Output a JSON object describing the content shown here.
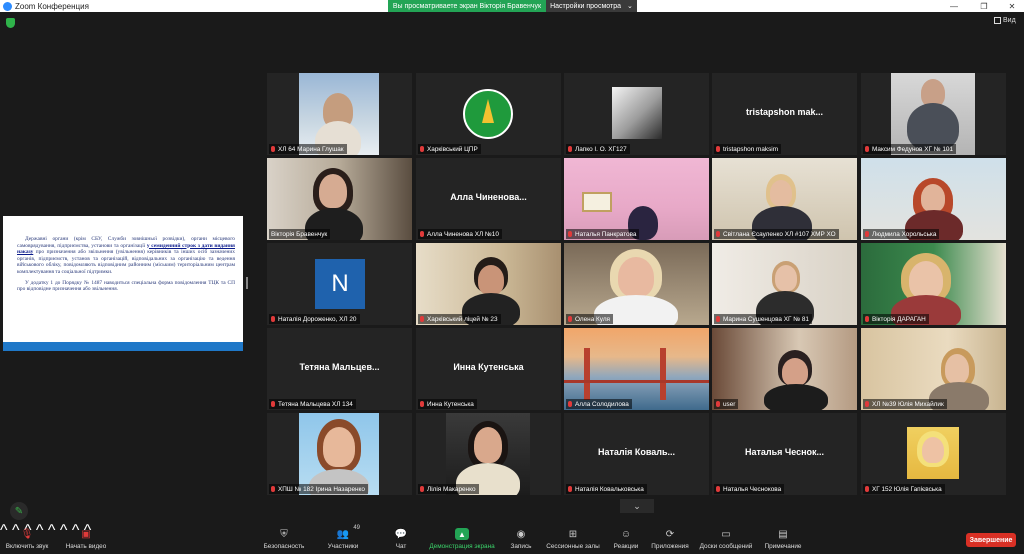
{
  "window": {
    "title": "Zoom Конференция",
    "share_banner": "Вы просматриваете экран Вікторія Бравенчук",
    "view_options": "Настройки просмотра",
    "view_button": "Вид"
  },
  "shared_doc": {
    "paragraph1_a": "Державні органи (крім СБУ, Служби зовнішньої розвідки), органи місцевого самоврядування, підприємства, установи та організації",
    "paragraph1_highlight": "у семиденний строк з дати видання наказу",
    "paragraph1_b": "про призначення або звільнення (увільнення) керівників та інших осіб зазначених органів, підприємств, установ та організацій, відповідальних за організацію та ведення військового обліку, повідомляють відповідним районним (міським) територіальним центрам комплектування та соціальної підтримки.",
    "paragraph2": "У додатку 1 до Порядку № 1487 наводиться спеціальна форма повідомлення ТЦК та СП про відповідне призначення або звільнення."
  },
  "participants": [
    {
      "name": "ХЛ 64 Марина Глушак",
      "display": "",
      "muted": true
    },
    {
      "name": "Харківський ЦПР",
      "display": "",
      "muted": true
    },
    {
      "name": "Лапко І. О. ХГ127",
      "display": "",
      "muted": true
    },
    {
      "name": "tristapshon maksim",
      "display": "tristapshon mak...",
      "muted": true
    },
    {
      "name": "Максим Федунов ХГ № 101",
      "display": "",
      "muted": true
    },
    {
      "name": "Вікторія Бравенчук",
      "display": "",
      "muted": false
    },
    {
      "name": "Алла Чиненова ХЛ №10",
      "display": "Алла Чиненова...",
      "muted": true
    },
    {
      "name": "Наталья Панкратова",
      "display": "",
      "muted": true
    },
    {
      "name": "Світлана Єсауленко ХЛ #107 ХМР ХО",
      "display": "",
      "muted": true
    },
    {
      "name": "Людмила Хорольська",
      "display": "",
      "muted": true
    },
    {
      "name": "Наталія Дороженко, ХЛ 20",
      "display": "",
      "avatar_letter": "N",
      "muted": true
    },
    {
      "name": "Харківський ліцей № 23",
      "display": "",
      "muted": true
    },
    {
      "name": "Олена Куля",
      "display": "",
      "muted": true
    },
    {
      "name": "Марина Сушенцова ХГ № 81",
      "display": "",
      "muted": true
    },
    {
      "name": "Вікторія ДАРАГАН",
      "display": "",
      "muted": true
    },
    {
      "name": "Тетяна Мальцева ХЛ 134",
      "display": "Тетяна Мальцев...",
      "muted": true
    },
    {
      "name": "Инна Кутенська",
      "display": "Инна Кутенська",
      "muted": true
    },
    {
      "name": "Алла Солодилова",
      "display": "",
      "muted": true
    },
    {
      "name": "user",
      "display": "",
      "muted": true
    },
    {
      "name": "ХЛ №39 Юлія Михайлик",
      "display": "",
      "muted": true
    },
    {
      "name": "ХПШ № 182 Ірина Назаренко",
      "display": "",
      "muted": true
    },
    {
      "name": "Лілія Макаренко",
      "display": "",
      "muted": true
    },
    {
      "name": "Наталія Ковальковська",
      "display": "Наталія Коваль...",
      "muted": true
    },
    {
      "name": "Наталья Чеснокова",
      "display": "Наталья Чеснок...",
      "muted": true
    },
    {
      "name": "ХГ 152 Юлія Гапієвська",
      "display": "",
      "muted": true
    }
  ],
  "controls": {
    "audio": "Включить звук",
    "video": "Начать видео",
    "security": "Безопасность",
    "participants": "Участники",
    "participants_count": "49",
    "chat": "Чат",
    "share": "Демонстрация экрана",
    "record": "Запись",
    "breakout": "Сессионные залы",
    "reactions": "Реакции",
    "apps": "Приложения",
    "whiteboard": "Доски сообщений",
    "notes": "Примечание",
    "end": "Завершение"
  },
  "colors": {
    "share_green": "#23a455",
    "end_red": "#d93025",
    "active_speaker": "#e7d44a",
    "muted_red": "#e03a3a"
  }
}
